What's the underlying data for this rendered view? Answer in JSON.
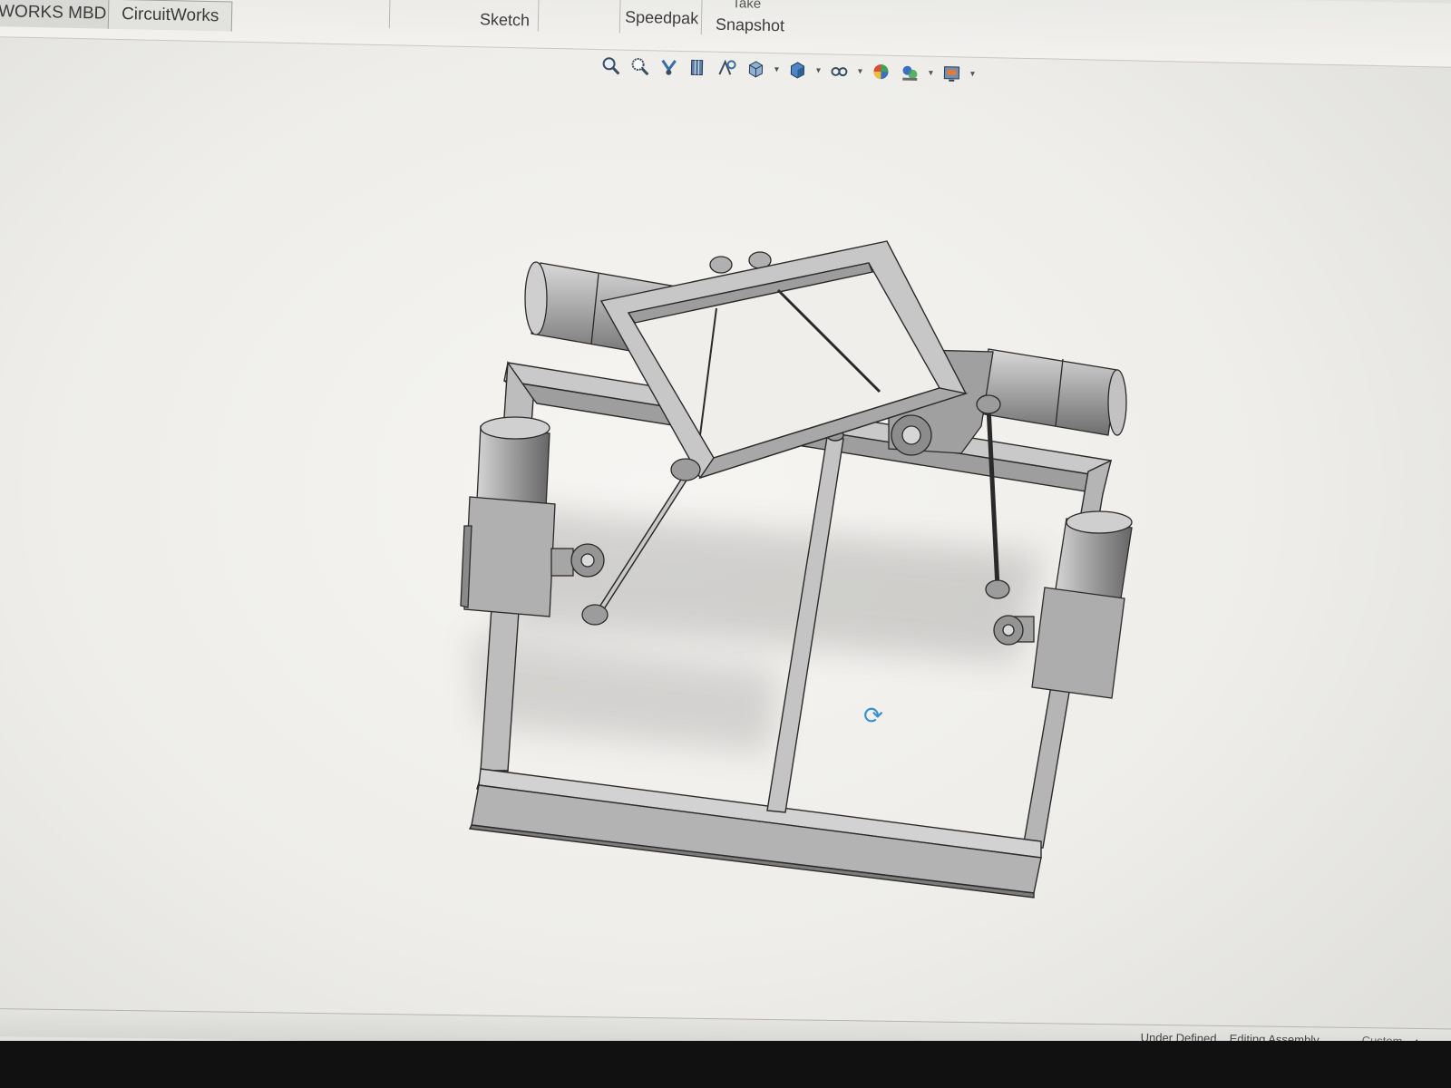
{
  "command_manager": {
    "tabs": [
      {
        "label": "WORKS MBD"
      },
      {
        "label": "CircuitWorks"
      }
    ],
    "buttons": {
      "sketch": "Sketch",
      "speedpak": "Speedpak",
      "snapshot": "Snapshot",
      "take_partial": "Take"
    }
  },
  "heads_up_toolbar": {
    "icons": [
      "zoom-to-fit-icon",
      "zoom-to-area-icon",
      "previous-view-icon",
      "section-view-icon",
      "dynamic-annotation-icon",
      "view-orientation-icon",
      "display-style-icon",
      "hide-show-items-icon",
      "edit-appearance-icon",
      "apply-scene-icon",
      "view-settings-icon"
    ]
  },
  "graphics_area": {
    "cursor": "rotate-view-icon"
  },
  "status_bar": {
    "definition_state": "Under Defined",
    "mode": "Editing Assembly",
    "units": "Custom"
  },
  "colors": {
    "viewport_background": "#f3f2ef",
    "model_gray": "#b9b9b9",
    "model_edge": "#2a2a2a",
    "cursor_blue": "#3a8fd0"
  }
}
